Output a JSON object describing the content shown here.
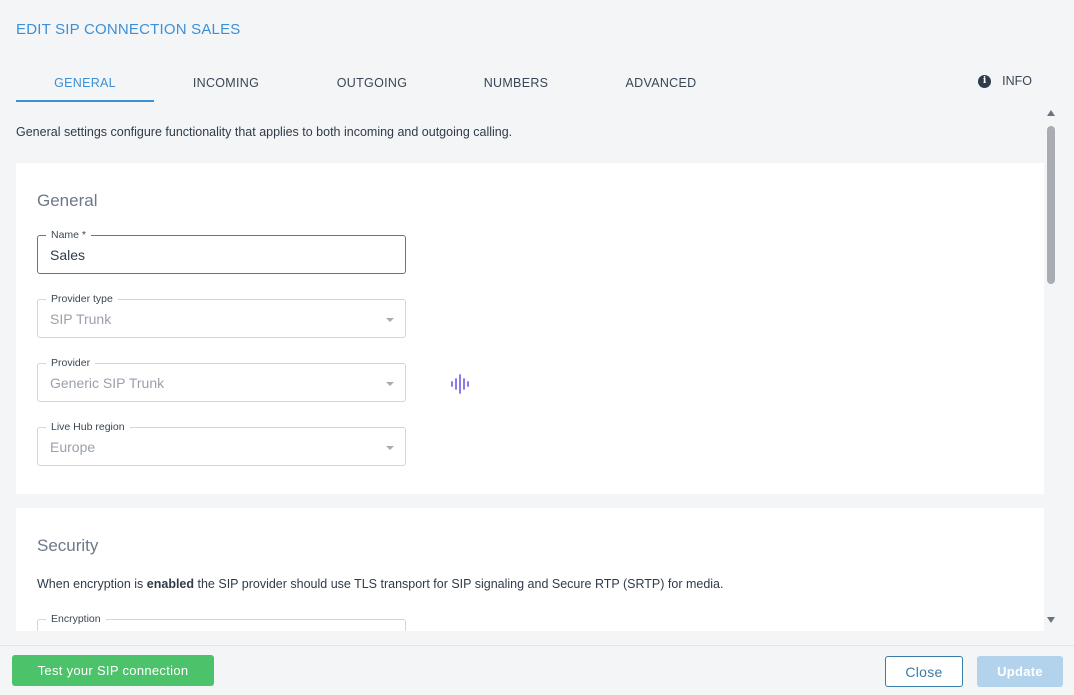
{
  "dialog": {
    "title": "EDIT SIP CONNECTION SALES"
  },
  "tabs": [
    {
      "label": "GENERAL",
      "active": true
    },
    {
      "label": "INCOMING",
      "active": false
    },
    {
      "label": "OUTGOING",
      "active": false
    },
    {
      "label": "NUMBERS",
      "active": false
    },
    {
      "label": "ADVANCED",
      "active": false
    }
  ],
  "info_tab": {
    "label": "INFO",
    "icon": "info-icon"
  },
  "intro_text": "General settings configure functionality that applies to both incoming and outgoing calling.",
  "general": {
    "title": "General",
    "fields": {
      "name": {
        "label": "Name *",
        "value": "Sales"
      },
      "provider_type": {
        "label": "Provider type",
        "value": "SIP Trunk"
      },
      "provider": {
        "label": "Provider",
        "value": "Generic SIP Trunk"
      },
      "region": {
        "label": "Live Hub region",
        "value": "Europe"
      }
    },
    "provider_icon": "sound-wave-icon"
  },
  "security": {
    "title": "Security",
    "desc_before": "When encryption is ",
    "desc_bold": "enabled",
    "desc_after": " the SIP provider should use TLS transport for SIP signaling and Secure RTP (SRTP) for media.",
    "encryption_label": "Encryption"
  },
  "footer": {
    "test_label": "Test your SIP connection",
    "close_label": "Close",
    "update_label": "Update"
  },
  "colors": {
    "accent": "#3d8fd6",
    "success": "#4cc26b",
    "update_disabled": "#b3d3ec",
    "wave": "#7b6cf0"
  }
}
